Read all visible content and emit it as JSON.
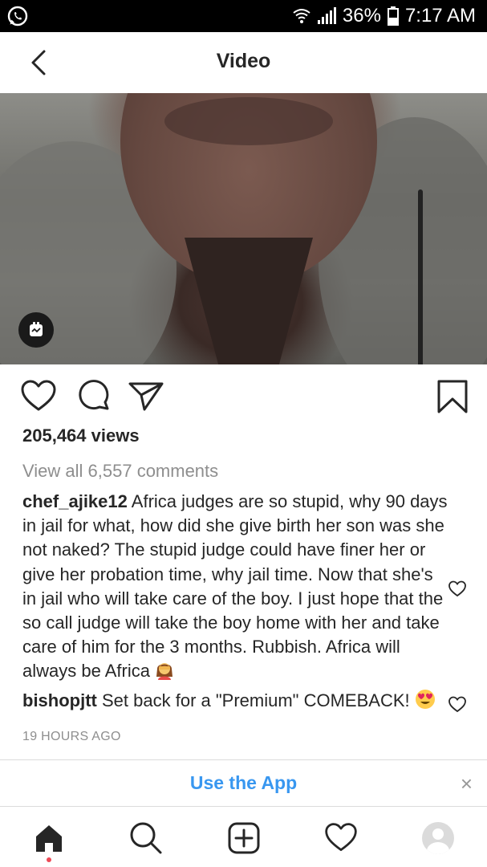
{
  "status_bar": {
    "battery": "36%",
    "time": "7:17 AM",
    "icons": [
      "whatsapp-icon",
      "wifi-icon",
      "signal-icon",
      "battery-icon"
    ]
  },
  "header": {
    "title": "Video",
    "back_icon": "back-arrow-icon"
  },
  "post": {
    "views": "205,464 views",
    "view_all_comments": "View all 6,557 comments",
    "action_icons": [
      "heart-icon",
      "comment-icon",
      "share-icon",
      "bookmark-icon"
    ],
    "comments": [
      {
        "user": "chef_ajike12",
        "text": "Africa judges are so stupid, why 90 days in jail for what, how did she give birth her son was she not naked? The stupid judge could have finer her or give her probation time, why jail time. Now that she's in jail who will take care of the boy. I just hope that the so call judge will take the boy home with her and take care of him for the 3 months. Rubbish. Africa will always be Africa",
        "emoji": "woman-facepalm-emoji"
      },
      {
        "user": "bishopjtt",
        "text": "Set back for a \"Premium\" COMEBACK!",
        "emoji": "heart-eyes-emoji"
      }
    ],
    "timestamp": "19 HOURS AGO"
  },
  "banner": {
    "label": "Use the App",
    "close_label": "×"
  },
  "bottom_nav": {
    "items": [
      "home-icon",
      "search-icon",
      "add-post-icon",
      "activity-heart-icon",
      "profile-avatar"
    ]
  },
  "colors": {
    "link_blue": "#3897f0",
    "secondary_text": "#8e8e8e",
    "primary_text": "#262626",
    "notification_dot": "#ed4956"
  }
}
